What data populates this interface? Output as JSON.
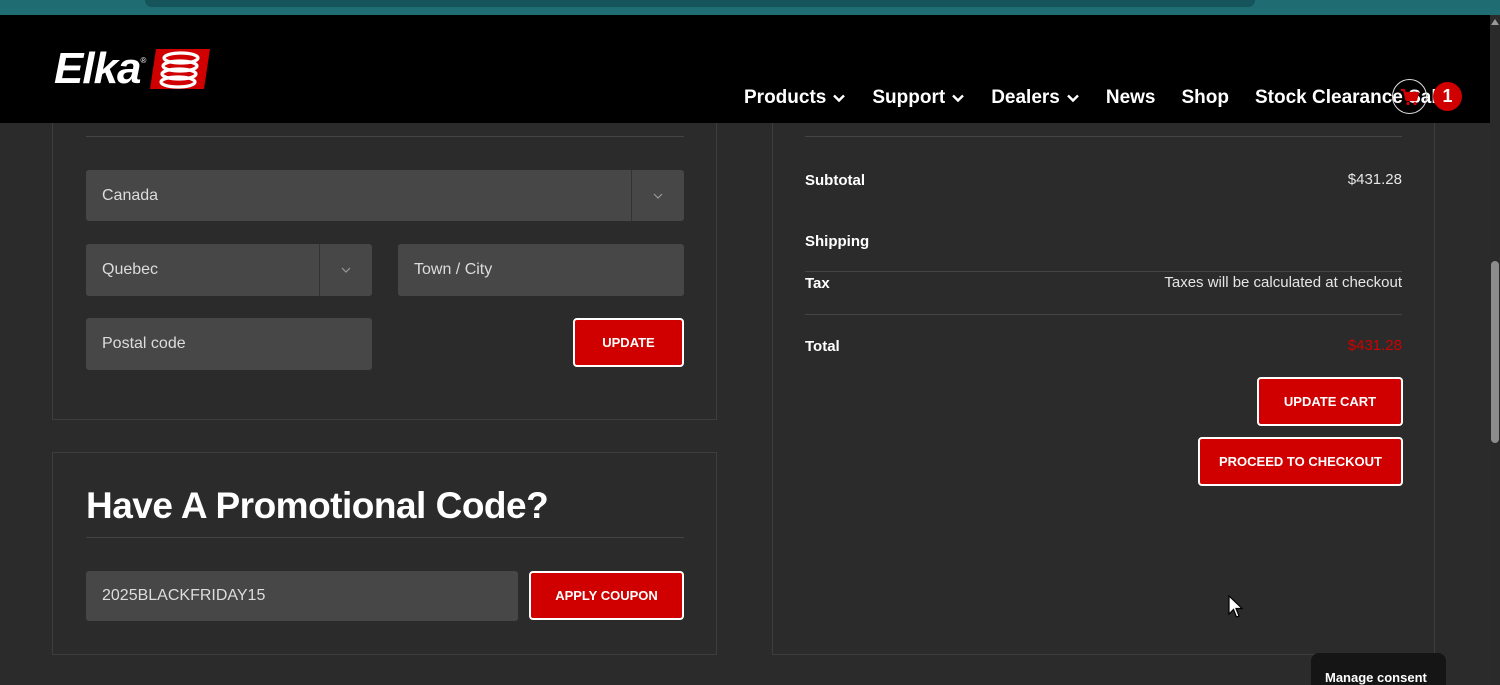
{
  "brand": {
    "logo_text": "Elka",
    "logo_reg": "®",
    "accent": "#d00000"
  },
  "nav": {
    "items": [
      {
        "label": "Products",
        "has_dropdown": true
      },
      {
        "label": "Support",
        "has_dropdown": true
      },
      {
        "label": "Dealers",
        "has_dropdown": true
      },
      {
        "label": "News",
        "has_dropdown": false
      },
      {
        "label": "Shop",
        "has_dropdown": false
      },
      {
        "label": "Stock Clearance Sale",
        "has_dropdown": false
      }
    ],
    "cart_icon": "cart-icon",
    "cart_count": "1"
  },
  "shipping_calc": {
    "country": "Canada",
    "province": "Quebec",
    "city_placeholder": "Town / City",
    "postal_placeholder": "Postal code",
    "update_label": "UPDATE"
  },
  "promo": {
    "title": "Have A Promotional Code?",
    "code_value": "2025BLACKFRIDAY15",
    "apply_label": "APPLY COUPON"
  },
  "totals": {
    "subtotal_label": "Subtotal",
    "subtotal_value": "$431.28",
    "shipping_label": "Shipping",
    "tax_label": "Tax",
    "tax_value": "Taxes will be calculated at checkout",
    "total_label": "Total",
    "total_value": "$431.28",
    "update_cart_label": "UPDATE CART",
    "checkout_label": "PROCEED TO CHECKOUT"
  },
  "consent": {
    "label": "Manage consent"
  }
}
